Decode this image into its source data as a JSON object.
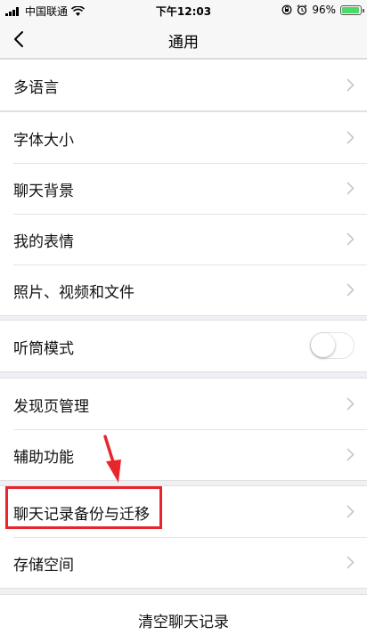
{
  "status_bar": {
    "carrier": "中国联通",
    "time": "下午12:03",
    "battery_percent": "96%",
    "battery_level": 0.96,
    "icons": [
      "signal-icon",
      "wifi-icon",
      "lock-rotation-icon",
      "alarm-icon",
      "battery-icon"
    ]
  },
  "nav": {
    "title": "通用",
    "back_icon": "chevron-left-icon"
  },
  "groups": [
    {
      "items": [
        {
          "label": "多语言",
          "type": "link"
        }
      ]
    },
    {
      "items": [
        {
          "label": "字体大小",
          "type": "link"
        },
        {
          "label": "聊天背景",
          "type": "link"
        },
        {
          "label": "我的表情",
          "type": "link"
        },
        {
          "label": "照片、视频和文件",
          "type": "link"
        }
      ]
    },
    {
      "items": [
        {
          "label": "听筒模式",
          "type": "toggle",
          "on": false
        }
      ]
    },
    {
      "items": [
        {
          "label": "发现页管理",
          "type": "link"
        },
        {
          "label": "辅助功能",
          "type": "link"
        }
      ]
    },
    {
      "items": [
        {
          "label": "聊天记录备份与迁移",
          "type": "link",
          "highlighted": true
        },
        {
          "label": "存储空间",
          "type": "link"
        }
      ]
    }
  ],
  "clear_chat": {
    "label": "清空聊天记录"
  },
  "colors": {
    "background": "#efeff4",
    "highlight": "#e8252b",
    "battery": "#4cd964",
    "chevron": "#c7c7cc"
  }
}
